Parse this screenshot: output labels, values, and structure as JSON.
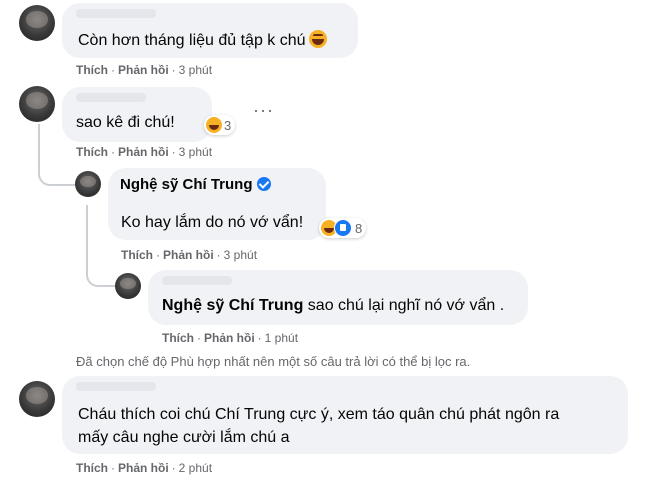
{
  "actions": {
    "like": "Thích",
    "reply": "Phản hồi",
    "sep": "·"
  },
  "comments": [
    {
      "text": "Còn hơn tháng liệu đủ tập k chú",
      "emoji": "squinting-laughing-emoji",
      "time": "3 phút"
    },
    {
      "text": "sao kê đi chú!",
      "reaction_count": "3",
      "time": "3 phút",
      "more": "···"
    },
    {
      "name": "Nghệ sỹ Chí Trung",
      "text": "Ko hay lắm do nó vớ vẩn!",
      "reaction_count": "8",
      "time": "3 phút"
    },
    {
      "tag": "Nghệ sỹ Chí Trung",
      "text": " sao chú lại nghĩ nó vớ vẩn .",
      "time": "1 phút"
    },
    {
      "line1": "Cháu thích coi chú Chí Trung cực ý, xem táo quân chú phát ngôn ra",
      "line2": "mấy câu nghe cười lắm chú a",
      "time": "2 phút"
    }
  ],
  "notice": "Đã chọn chế độ Phù hợp nhất nên một số câu trả lời có thể bị lọc ra.",
  "colors": {
    "bubble": "#f0f2f5",
    "meta": "#65676b",
    "verified": "#1877f2"
  }
}
